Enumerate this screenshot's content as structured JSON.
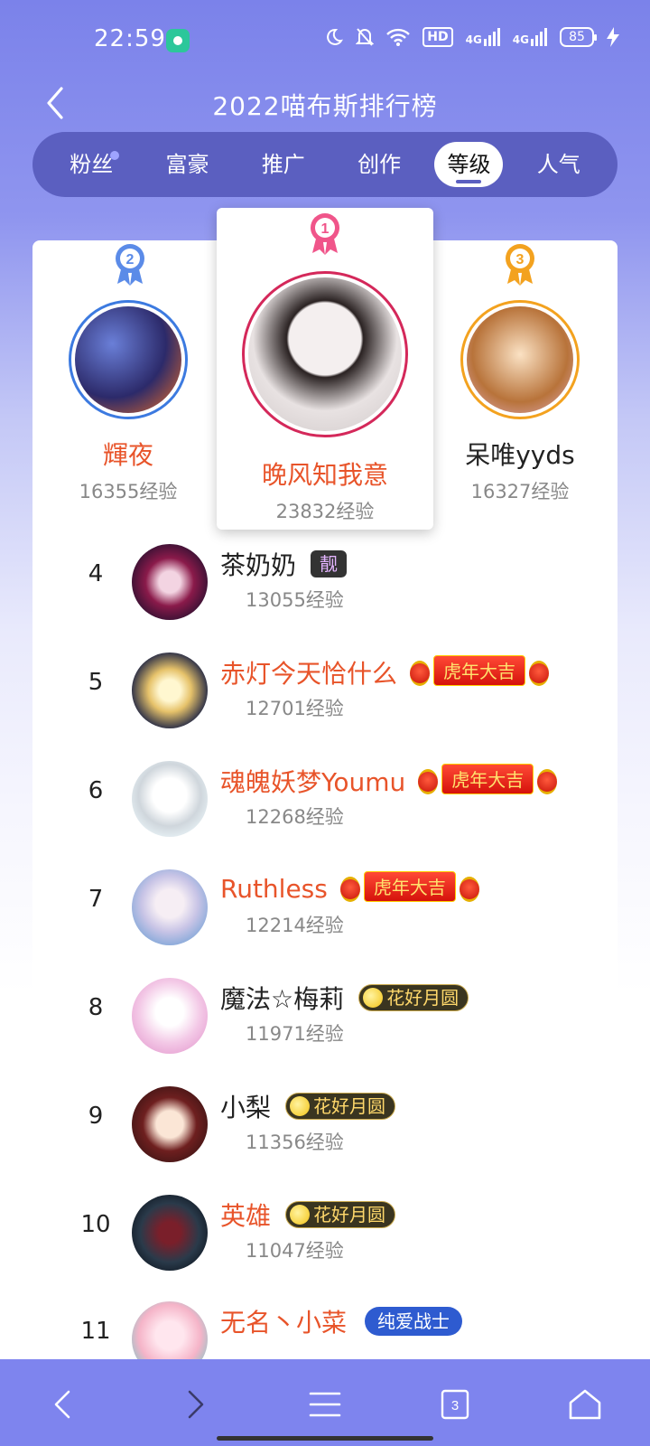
{
  "status_bar": {
    "time": "22:59",
    "hd_label": "HD",
    "net1": "4G",
    "net2": "4G",
    "battery": "85",
    "icons": [
      "moon-icon",
      "bell-off-icon",
      "wifi-icon",
      "signal-icon",
      "charging-icon"
    ]
  },
  "header": {
    "title": "2022喵布斯排行榜",
    "back_icon": "back-arrow-icon"
  },
  "tabs": [
    {
      "label": "粉丝",
      "active": false,
      "dot": true
    },
    {
      "label": "富豪",
      "active": false
    },
    {
      "label": "推广",
      "active": false
    },
    {
      "label": "创作",
      "active": false
    },
    {
      "label": "等级",
      "active": true
    },
    {
      "label": "人气",
      "active": false
    }
  ],
  "podium": {
    "first": {
      "rank": "1",
      "name": "晚风知我意",
      "exp": "23832经验",
      "name_color": "#e8542a",
      "ring_color": "#d4285a"
    },
    "second": {
      "rank": "2",
      "name": "輝夜",
      "exp": "16355经验",
      "name_color": "#e8542a",
      "ring_color": "#3c7ae0"
    },
    "third": {
      "rank": "3",
      "name": "呆唯yyds",
      "exp": "16327经验",
      "name_color": "#222222",
      "ring_color": "#f3a21f"
    }
  },
  "list": [
    {
      "rank": "4",
      "name": "茶奶奶",
      "exp": "13055经验",
      "orange": false,
      "badge": "靓",
      "badge_type": "liang"
    },
    {
      "rank": "5",
      "name": "赤灯今天恰什么",
      "exp": "12701经验",
      "orange": true,
      "badge": "虎年大吉",
      "badge_type": "tiger"
    },
    {
      "rank": "6",
      "name": "魂魄妖梦Youmu",
      "exp": "12268经验",
      "orange": true,
      "badge": "虎年大吉",
      "badge_type": "tiger"
    },
    {
      "rank": "7",
      "name": "Ruthless",
      "exp": "12214经验",
      "orange": true,
      "badge": "虎年大吉",
      "badge_type": "tiger"
    },
    {
      "rank": "8",
      "name": "魔法☆梅莉",
      "exp": "11971经验",
      "orange": false,
      "badge": "花好月圆",
      "badge_type": "moon"
    },
    {
      "rank": "9",
      "name": "小梨",
      "exp": "11356经验",
      "orange": false,
      "badge": "花好月圆",
      "badge_type": "moon"
    },
    {
      "rank": "10",
      "name": "英雄",
      "exp": "11047经验",
      "orange": true,
      "badge": "花好月圆",
      "badge_type": "moon"
    },
    {
      "rank": "11",
      "name": "无名丶小菜",
      "exp": "",
      "orange": true,
      "badge": "纯爱战士",
      "badge_type": "warrior"
    }
  ],
  "bottom_nav": {
    "tab_count": "3",
    "icons": [
      "back-icon",
      "forward-icon",
      "menu-icon",
      "tabs-icon",
      "home-icon"
    ]
  }
}
